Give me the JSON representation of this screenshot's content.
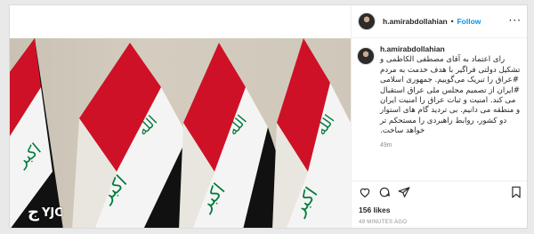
{
  "post": {
    "username": "h.amirabdollahian",
    "separator": "•",
    "follow_label": "Follow",
    "more_label": "···",
    "caption_username": "h.amirabdollahian",
    "caption_text": "رای اعتماد به آقای مصطفی الکاظمی و تشکیل دولتی فراگیر با هدف خدمت به مردم #عراق را تبریک می‌گوییم. جمهوری اسلامی #ایران از تصمیم مجلس ملی عراق استقبال می کند. امنیت و ثبات عراق را امنیت ایران و منطقه می دانیم. بی تردید گام های استوار دو کشور، روابط راهبردی را مستحکم تر خواهد ساخت.",
    "caption_time": "49m",
    "likes": "156 likes",
    "posted_ago": "49 MINUTES AGO",
    "watermark": "YJC",
    "watermark_mark": "ج"
  },
  "icons": {
    "like": "heart-icon",
    "comment": "comment-icon",
    "share": "share-icon",
    "save": "bookmark-icon"
  },
  "colors": {
    "follow": "#0095f6",
    "flag_red": "#ce1126",
    "flag_white": "#ffffff",
    "flag_black": "#111111",
    "flag_green": "#007a3d"
  }
}
